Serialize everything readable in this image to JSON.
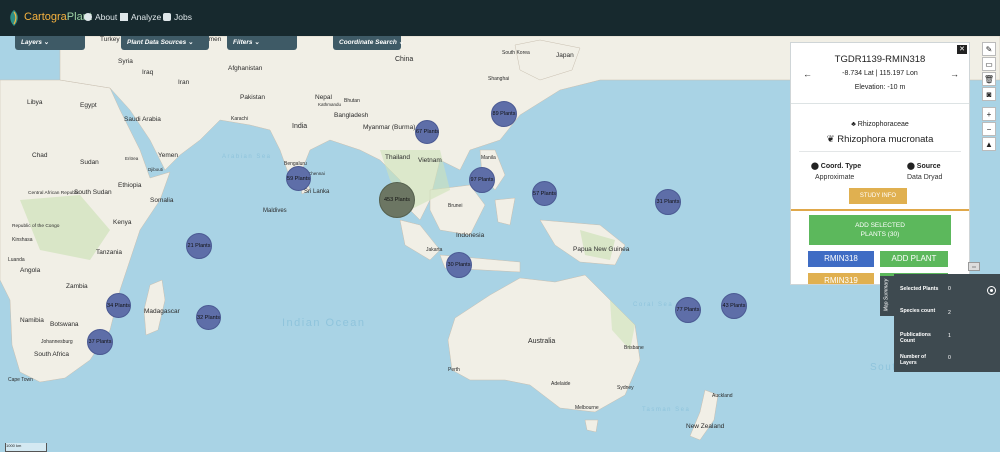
{
  "nav": {
    "brand_a": "Cartogra",
    "brand_b": "Plant",
    "about": "About",
    "analyze": "Analyze",
    "jobs": "Jobs"
  },
  "menus": {
    "layers": "Layers",
    "plant_data_sources": "Plant Data Sources",
    "filters": "Filters",
    "coordinate_search": "Coordinate Search"
  },
  "map_labels": {
    "countries": [
      "Turkey",
      "Turkmen",
      "China",
      "South Korea",
      "Japan",
      "Syria",
      "Iraq",
      "Afghanistan",
      "Iran",
      "Libya",
      "Egypt",
      "Pakistan",
      "Nepal",
      "Bhutan",
      "Saudi Arabia",
      "India",
      "Bangladesh",
      "Myanmar (Burma)",
      "Thailand",
      "Vietnam",
      "Sudan",
      "Chad",
      "Yemen",
      "Djibouti",
      "Eritrea",
      "South Sudan",
      "Ethiopia",
      "Central African Republic",
      "Somalia",
      "Sri Lanka",
      "Maldives",
      "Brunei",
      "Kenya",
      "Republic of the Congo",
      "Indonesia",
      "Papua New Guinea",
      "Tanzania",
      "Angola",
      "Zambia",
      "Madagascar",
      "Namibia",
      "Botswana",
      "South Africa",
      "Australia",
      "New Zealand"
    ],
    "cities": [
      "Shanghai",
      "Karachi",
      "Bengaluru",
      "Manila",
      "Jakarta",
      "Kinshasa",
      "Luanda",
      "Johannesburg",
      "Cape Town",
      "Perth",
      "Adelaide",
      "Brisbane",
      "Sydney",
      "Melbourne",
      "Auckland",
      "Chennai",
      "Kathmandu"
    ],
    "seas": [
      "Arabian Sea",
      "Indian Ocean",
      "South Pacific Ocean",
      "Coral Sea",
      "Tasman Sea"
    ]
  },
  "clusters": [
    {
      "label": "67 Plants"
    },
    {
      "label": "89 Plants"
    },
    {
      "label": "59 Plants"
    },
    {
      "label": "453 Plants"
    },
    {
      "label": "97 Plants"
    },
    {
      "label": "57 Plants"
    },
    {
      "label": "31 Plants"
    },
    {
      "label": "21 Plants"
    },
    {
      "label": "30 Plants"
    },
    {
      "label": "34 Plants"
    },
    {
      "label": "32 Plants"
    },
    {
      "label": "37 Plants"
    },
    {
      "label": "77 Plants"
    },
    {
      "label": "43 Plants"
    }
  ],
  "popup": {
    "plant_id": "TGDR1139-RMIN318",
    "coords": "-8.734 Lat | 115.197 Lon",
    "elevation": "Elevation: -10 m",
    "family": "Rhizophoraceae",
    "species": "Rhizophora mucronata",
    "coord_type_label": "Coord. Type",
    "coord_type_value": "Approximate",
    "source_label": "Source",
    "source_value": "Data Dryad",
    "study_info": "STUDY INFO",
    "add_selected_1": "ADD SELECTED",
    "add_selected_2": "PLANTS (30)",
    "rows": [
      {
        "id": "RMIN318",
        "action": "ADD PLANT"
      },
      {
        "id": "RMIN319",
        "action": "ADD PLANT"
      }
    ]
  },
  "summary": {
    "tab_label": "Map Summary",
    "rows": [
      {
        "label": "Selected Plants",
        "value": "0"
      },
      {
        "label": "Species count",
        "value": "2"
      },
      {
        "label": "Publications Count",
        "value": "1"
      },
      {
        "label": "Number of Layers",
        "value": "0"
      }
    ]
  },
  "scale": "1000 km",
  "colors": {
    "nav_bg": "#17292e",
    "ocean": "#a9d3e5",
    "land": "#f1efe6",
    "cluster": "#5e6ea8",
    "cluster_big": "#6c7663",
    "green_button": "#5cb85c",
    "blue_button": "#3f6cc4",
    "gold_button": "#e0b050"
  }
}
